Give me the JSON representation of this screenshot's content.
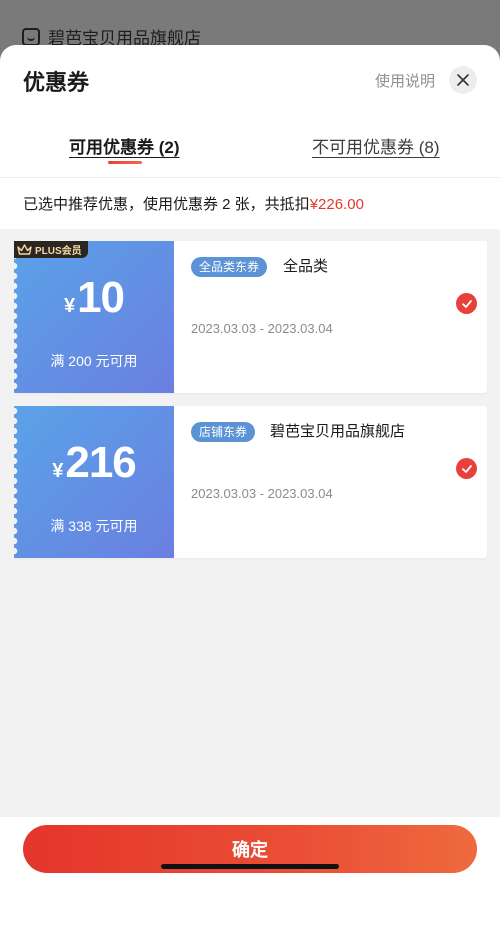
{
  "background": {
    "store_name": "碧芭宝贝用品旗舰店"
  },
  "header": {
    "title": "优惠券",
    "help_label": "使用说明",
    "close_icon": "close-icon"
  },
  "tabs": [
    {
      "label": "可用优惠券 (2)",
      "active": true
    },
    {
      "label": "不可用优惠券 (8)",
      "active": false
    }
  ],
  "summary": {
    "text": "已选中推荐优惠，使用优惠券 2 张，共抵扣",
    "amount": "¥226.00"
  },
  "coupons": [
    {
      "badge": "PLUS会员",
      "currency": "¥",
      "value": "10",
      "threshold": "满 200 元可用",
      "type": "全品类东券",
      "scope": "全品类",
      "dates": "2023.03.03 - 2023.03.04",
      "selected": true
    },
    {
      "currency": "¥",
      "value": "216",
      "threshold": "满 338 元可用",
      "type": "店铺东券",
      "scope": "碧芭宝贝用品旗舰店",
      "dates": "2023.03.03 - 2023.03.04",
      "selected": true
    }
  ],
  "footer": {
    "confirm_label": "确定"
  },
  "colors": {
    "accent": "#e8403a",
    "coupon_gradient_start": "#5aa2e8",
    "coupon_gradient_end": "#6a7fe0",
    "tag_blue": "#5b93d6"
  }
}
